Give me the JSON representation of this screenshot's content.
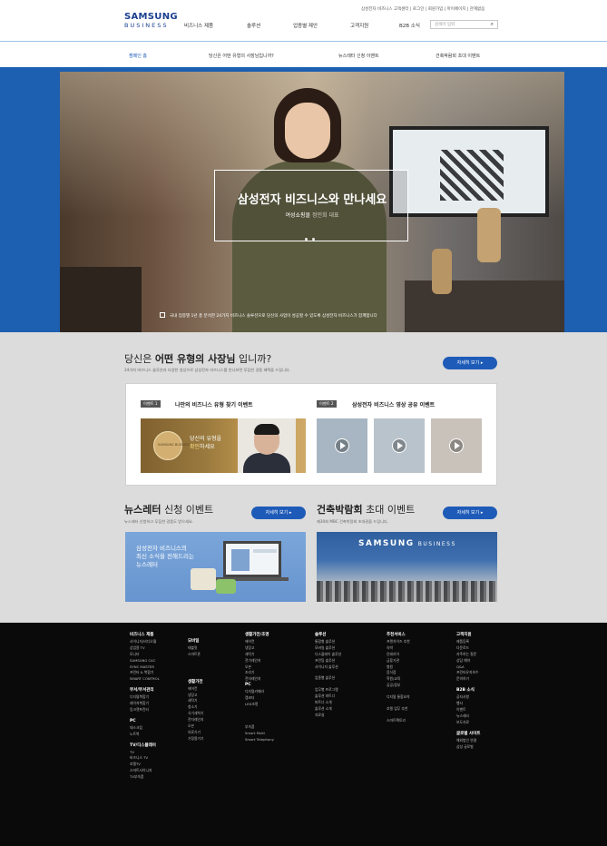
{
  "header": {
    "logo_line1": "SAMSUNG",
    "logo_line2": "BUSINESS",
    "util_links": "삼성전자 비즈니스 고객센터 | 로그인 | 회원가입 | 마이페이지 | 관계없음",
    "nav": [
      "비즈니스 제품",
      "솔루션",
      "업종별 제안",
      "고객지원",
      "B2B 소식"
    ],
    "search_placeholder": "검색어 입력",
    "search_icon": "search-icon"
  },
  "subnav": {
    "items": [
      "캠페인 홈",
      "당신은 어떤 유형의 사장님입니까?",
      "뉴스레터 신청 이벤트",
      "건축박람회 초대 이벤트"
    ]
  },
  "hero": {
    "title": "삼성전자 비즈니스와 만나세요",
    "subtitle_main": "여성쇼핑몰",
    "subtitle_dim": "정민희 대표",
    "caption": "국내 업종별 1년 총 분석한 24가지 비즈니스 솔루션으로 당신의 사업이 성공할 수 있도록 삼성전자 비즈니스가 함께합니다"
  },
  "section_type": {
    "title_prefix": "당신은",
    "title_bold": "어떤 유형의 사장님",
    "title_suffix": "입니까?",
    "desc": "24가지 비즈니스 솔루션과 다양한 영상으로 삼성전자 비즈니스를 만나보면 푸짐한 경품 혜택을 드립니다.",
    "more_label": "자세히 보기 ▸",
    "event1": {
      "tag": "이벤트 1",
      "title": "나만의 비즈니스 유형 찾기 이벤트",
      "seal": "SAMSUNG BUSINESS",
      "text_line1": "당신의 유형을",
      "text_hl": "확인",
      "text_line2_rest": "하세요"
    },
    "event2": {
      "tag": "이벤트 2",
      "title": "삼성전자 비즈니스 영상 공유 이벤트"
    }
  },
  "section_news": {
    "title_bold": "뉴스레터",
    "title_rest": "신청 이벤트",
    "desc": "뉴스레터 신청하고 푸짐한 경품도 받으세요.",
    "more_label": "자세히 보기 ▸",
    "img_line1": "삼성전자 비즈니스의",
    "img_line2": "최신 소식을 전해드리는",
    "img_line3": "뉴스레터"
  },
  "section_expo": {
    "title_bold": "건축박람회",
    "title_rest": "초대 이벤트",
    "desc": "제30회 MBC 건축박람회 초대권을 드립니다.",
    "more_label": "자세히 보기 ▸",
    "sign_main": "SAMSUNG",
    "sign_sub": "BUSINESS"
  },
  "footer": {
    "col1": [
      "비즈니스 제품",
      "사이니지/비디오월",
      "상업용 TV",
      "모니터",
      "SAMSUNG CAC",
      "SYNC MASTER",
      "프린터 & 복합기",
      "SMART CONTROL",
      "",
      "부서/부서관리",
      "디지털복합기",
      "레이저복합기",
      "잉크젯프린터",
      "",
      "PC",
      "데스크탑",
      "노트북",
      "",
      "TV/디스플레이",
      "TV",
      "비즈니스 TV",
      "호텔TV",
      "스마트사이니지",
      "TV부속품"
    ],
    "col2": [
      "모바일",
      "태블릿",
      "스마트폰",
      "",
      "",
      "",
      "",
      "생활가전",
      "에어컨",
      "냉장고",
      "세탁기",
      "청소기",
      "식기세척기",
      "전자레인지",
      "오븐",
      "의료기기",
      "가정용기기"
    ],
    "col3": [
      "생활가전/조명",
      "에어컨",
      "냉장고",
      "세탁기",
      "전기레인지",
      "오븐",
      "조리기",
      "전자레인지",
      "PC",
      "디지털카메라",
      "캠코더",
      "LED조명",
      "",
      "",
      "",
      "부속품",
      "Smart Multi",
      "Smart Telephony"
    ],
    "col4": [
      "솔루션",
      "통합형 솔루션",
      "모바일 솔루션",
      "디스플레이 솔루션",
      "프린팅 솔루션",
      "사이니지 솔루션",
      "",
      "업종별 솔루션",
      "",
      "업무별 프로그램",
      "솔루션 파트너",
      "파트너 소개",
      "솔루션 소개",
      "자료실"
    ],
    "col5": [
      "추천서비스",
      "프랜차이즈 추천",
      "숙박",
      "인테리어",
      "금융기관",
      "병원",
      "음식점",
      "학원/교육",
      "공공/정부",
      "",
      "디지털 통합요약",
      "",
      "호텔 업무 추천",
      "",
      "스마트팩토리"
    ],
    "col6": [
      "고객지원",
      "제품등록",
      "다운로드",
      "자주하는 질문",
      "상담 예약",
      "Q&A",
      "프린터유지보수",
      "문의하기",
      "",
      "B2B 소식",
      "공지사항",
      "행사",
      "이벤트",
      "뉴스레터",
      "보도자료",
      "",
      "글로벌 사이트",
      "해외법인 연결",
      "삼성 글로벌"
    ]
  }
}
